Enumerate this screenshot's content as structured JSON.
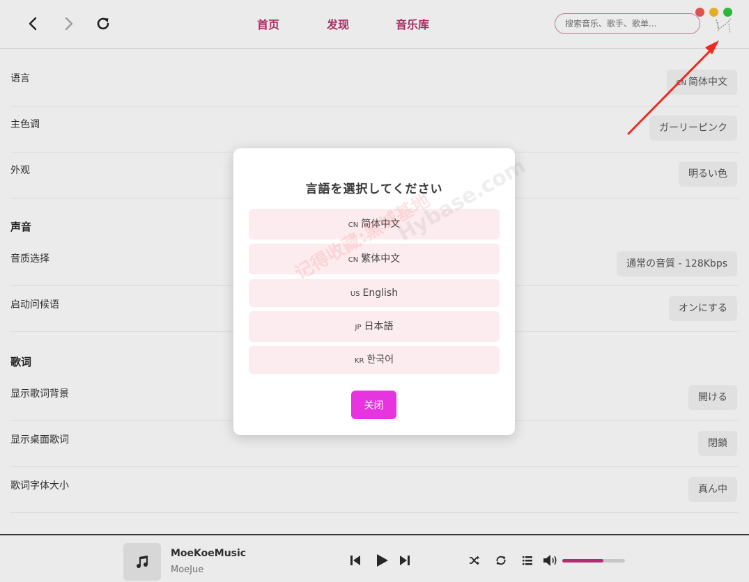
{
  "header": {
    "tabs": [
      {
        "label": "首页"
      },
      {
        "label": "发现"
      },
      {
        "label": "音乐库"
      }
    ],
    "search_placeholder": "搜索音乐、歌手、歌单...",
    "icons": {
      "back": "chevron-left-icon",
      "forward": "chevron-right-icon",
      "refresh": "refresh-icon",
      "user": "user-avatar-icon"
    },
    "window_controls": {
      "close_color": "#f25a57",
      "minimize_color": "#f9bd2e",
      "maximize_color": "#2ec840"
    },
    "accent_color": "#b8306e"
  },
  "settings": {
    "rows": [
      {
        "label": "语言",
        "value_code": "CN",
        "value": "简体中文"
      },
      {
        "label": "主色调",
        "value_code": "",
        "value": "ガーリーピンク"
      },
      {
        "label": "外观",
        "value_code": "",
        "value": "明るい色"
      }
    ],
    "sections": [
      {
        "title": "声音",
        "rows": [
          {
            "label": "音质选择",
            "value": "通常の音質 - 128Kbps"
          },
          {
            "label": "启动问候语",
            "value": "オンにする"
          }
        ]
      },
      {
        "title": "歌词",
        "rows": [
          {
            "label": "显示歌词背景",
            "value": "開ける"
          },
          {
            "label": "显示桌面歌词",
            "value": "閉鎖"
          },
          {
            "label": "歌词字体大小",
            "value": "真ん中"
          }
        ]
      }
    ]
  },
  "modal": {
    "title": "言語を選択してください",
    "options": [
      {
        "code": "CN",
        "label": "简体中文"
      },
      {
        "code": "CN",
        "label": "繁体中文"
      },
      {
        "code": "US",
        "label": "English"
      },
      {
        "code": "JP",
        "label": "日本語"
      },
      {
        "code": "KR",
        "label": "한국어"
      }
    ],
    "close_label": "关闭",
    "option_bg": "#fdecef",
    "close_color": "#e833e0"
  },
  "watermark": {
    "line1": "记得收藏:黑域基地",
    "line2": "Hybase.com"
  },
  "player": {
    "title": "MoeKoeMusic",
    "artist": "MoeJue",
    "cover_icon": "music-note-icon",
    "volume_percent": 65,
    "controls": [
      "previous-icon",
      "play-icon",
      "next-icon",
      "shuffle-icon",
      "repeat-icon",
      "playlist-icon",
      "volume-icon"
    ]
  }
}
